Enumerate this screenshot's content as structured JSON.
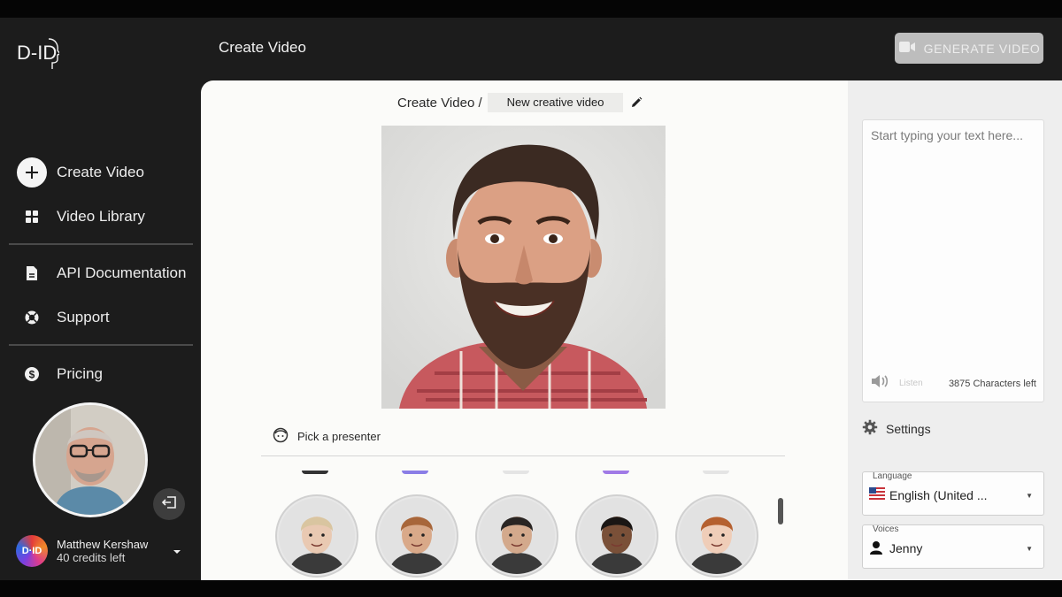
{
  "brand": {
    "logo_text": "D-ID"
  },
  "header": {
    "title": "Create Video",
    "generate_label": "GENERATE VIDEO"
  },
  "sidebar": {
    "items": [
      {
        "label": "Create Video"
      },
      {
        "label": "Video Library"
      },
      {
        "label": "API Documentation"
      },
      {
        "label": "Support"
      },
      {
        "label": "Pricing"
      }
    ],
    "user": {
      "name": "Matthew Kershaw",
      "credits": "40 credits left",
      "badge": "D·ID"
    }
  },
  "main": {
    "breadcrumb": {
      "root": "Create Video /",
      "name": "New creative video"
    },
    "pick_label": "Pick a presenter",
    "presenters": [
      {
        "name": "blonde-woman",
        "skin": "#e9c9b2",
        "hair": "#d9c5a0"
      },
      {
        "name": "red-beard-man",
        "skin": "#d9a989",
        "hair": "#a8663a"
      },
      {
        "name": "suited-man",
        "skin": "#d3a98c",
        "hair": "#2a2523"
      },
      {
        "name": "curly-hair-man",
        "skin": "#7a5038",
        "hair": "#1a1614"
      },
      {
        "name": "red-hair-woman",
        "skin": "#efcdb8",
        "hair": "#b5602f"
      }
    ]
  },
  "script_panel": {
    "placeholder": "Start typing your text here...",
    "listen_label": "Listen",
    "characters_left": "3875 Characters left"
  },
  "settings": {
    "title": "Settings",
    "language_label": "Language",
    "language_value": "English (United ...",
    "voices_label": "Voices",
    "voice_value": "Jenny"
  },
  "colors": {
    "sidebar_bg": "#1c1c1c",
    "canvas_bg": "#fbfbf9",
    "panel_bg": "#eeeeee",
    "button_bg": "#bdbdbd"
  }
}
